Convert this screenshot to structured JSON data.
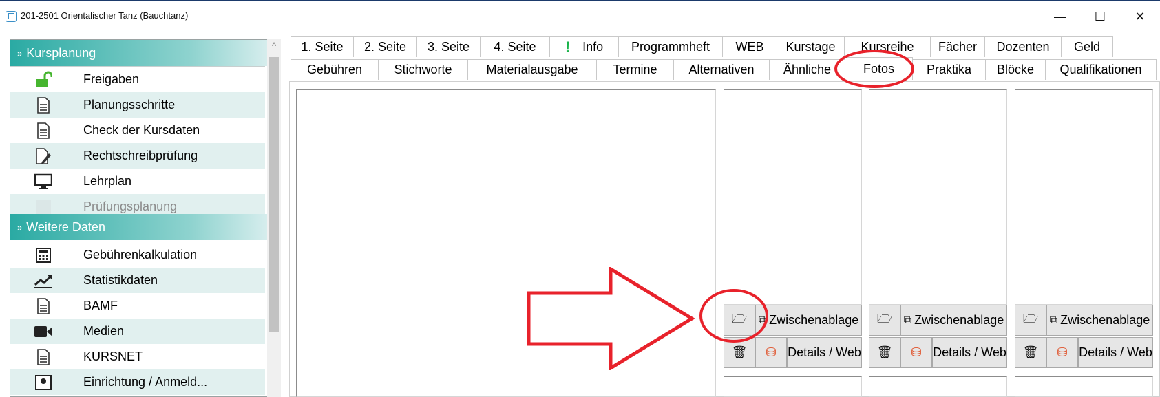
{
  "window": {
    "title": "201-2501 Orientalischer Tanz (Bauchtanz)",
    "minimize": "—",
    "maximize": "☐",
    "close": "✕"
  },
  "sidebar": {
    "scroll_up": "^",
    "groups": [
      {
        "label": "Kursplanung",
        "chevron": "»",
        "items": [
          {
            "label": "Freigaben",
            "icon": "unlock-icon",
            "glyph": "🔓"
          },
          {
            "label": "Planungsschritte",
            "icon": "document-icon",
            "glyph": "🗎"
          },
          {
            "label": "Check der Kursdaten",
            "icon": "document-icon",
            "glyph": "🗎"
          },
          {
            "label": "Rechtschreibprüfung",
            "icon": "document-edit-icon",
            "glyph": "✎"
          },
          {
            "label": "Lehrplan",
            "icon": "monitor-icon",
            "glyph": "🖥"
          },
          {
            "label": "Prüfungsplanung",
            "icon": "calendar-icon",
            "glyph": "▦",
            "disabled": true
          }
        ]
      },
      {
        "label": "Weitere Daten",
        "chevron": "»",
        "items": [
          {
            "label": "Gebührenkalkulation",
            "icon": "calculator-icon",
            "glyph": "▦"
          },
          {
            "label": "Statistikdaten",
            "icon": "chart-line-icon",
            "glyph": "📈"
          },
          {
            "label": "BAMF",
            "icon": "document-icon",
            "glyph": "🗎"
          },
          {
            "label": "Medien",
            "icon": "video-camera-icon",
            "glyph": "■"
          },
          {
            "label": "KURSNET",
            "icon": "document-icon",
            "glyph": "🗎"
          },
          {
            "label": "Einrichtung / Anmeld...",
            "icon": "contact-card-icon",
            "glyph": "▣"
          }
        ]
      }
    ]
  },
  "tabs": {
    "row1": [
      "1. Seite",
      "2. Seite",
      "3. Seite",
      "4. Seite",
      "Info",
      "Programmheft",
      "WEB",
      "Kurstage",
      "Kursreihe",
      "Fächer",
      "Dozenten",
      "Geld"
    ],
    "row2": [
      "Gebühren",
      "Stichworte",
      "Materialausgabe",
      "Termine",
      "Alternativen",
      "Ähnliche",
      "Fotos",
      "Praktika",
      "Blöcke",
      "Qualifikationen"
    ],
    "info_mark": "!",
    "active": "Fotos"
  },
  "photo_slots": {
    "open_icon": "folder-open-icon",
    "clipboard_label": "Zwischenablage",
    "delete_icon": "trash-icon",
    "details_label": "Details / Web",
    "glyphs": {
      "open": "🗁",
      "clipboard": "⧉",
      "delete": "🗑",
      "details": "⛁"
    }
  },
  "colors": {
    "header_gradient_start": "#2aaaa3",
    "annotation_red": "#e8222b",
    "alt_row": "#e1f0ef"
  }
}
